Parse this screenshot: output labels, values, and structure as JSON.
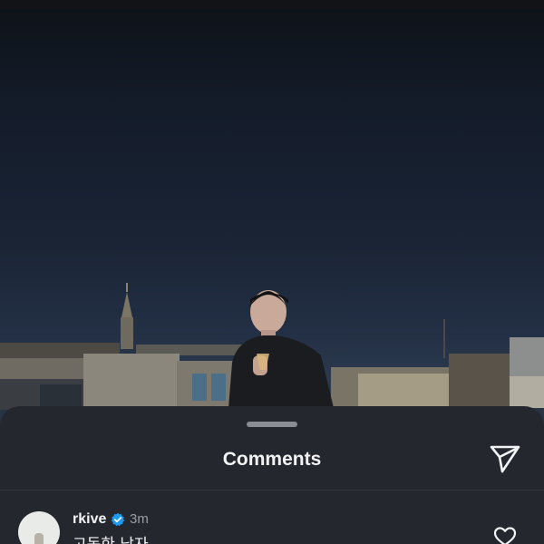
{
  "comments_sheet": {
    "title": "Comments",
    "send_icon": "paper-plane-icon"
  },
  "comments": [
    {
      "username": "rkive",
      "verified": true,
      "time": "3m",
      "text": "고독한 남자",
      "like_icon": "heart-outline-icon"
    }
  ],
  "colors": {
    "sheet_background": "#24272d",
    "verified_badge": "#1d9bf0",
    "text_primary": "#f2f3f5",
    "text_secondary": "#9a9da3"
  }
}
